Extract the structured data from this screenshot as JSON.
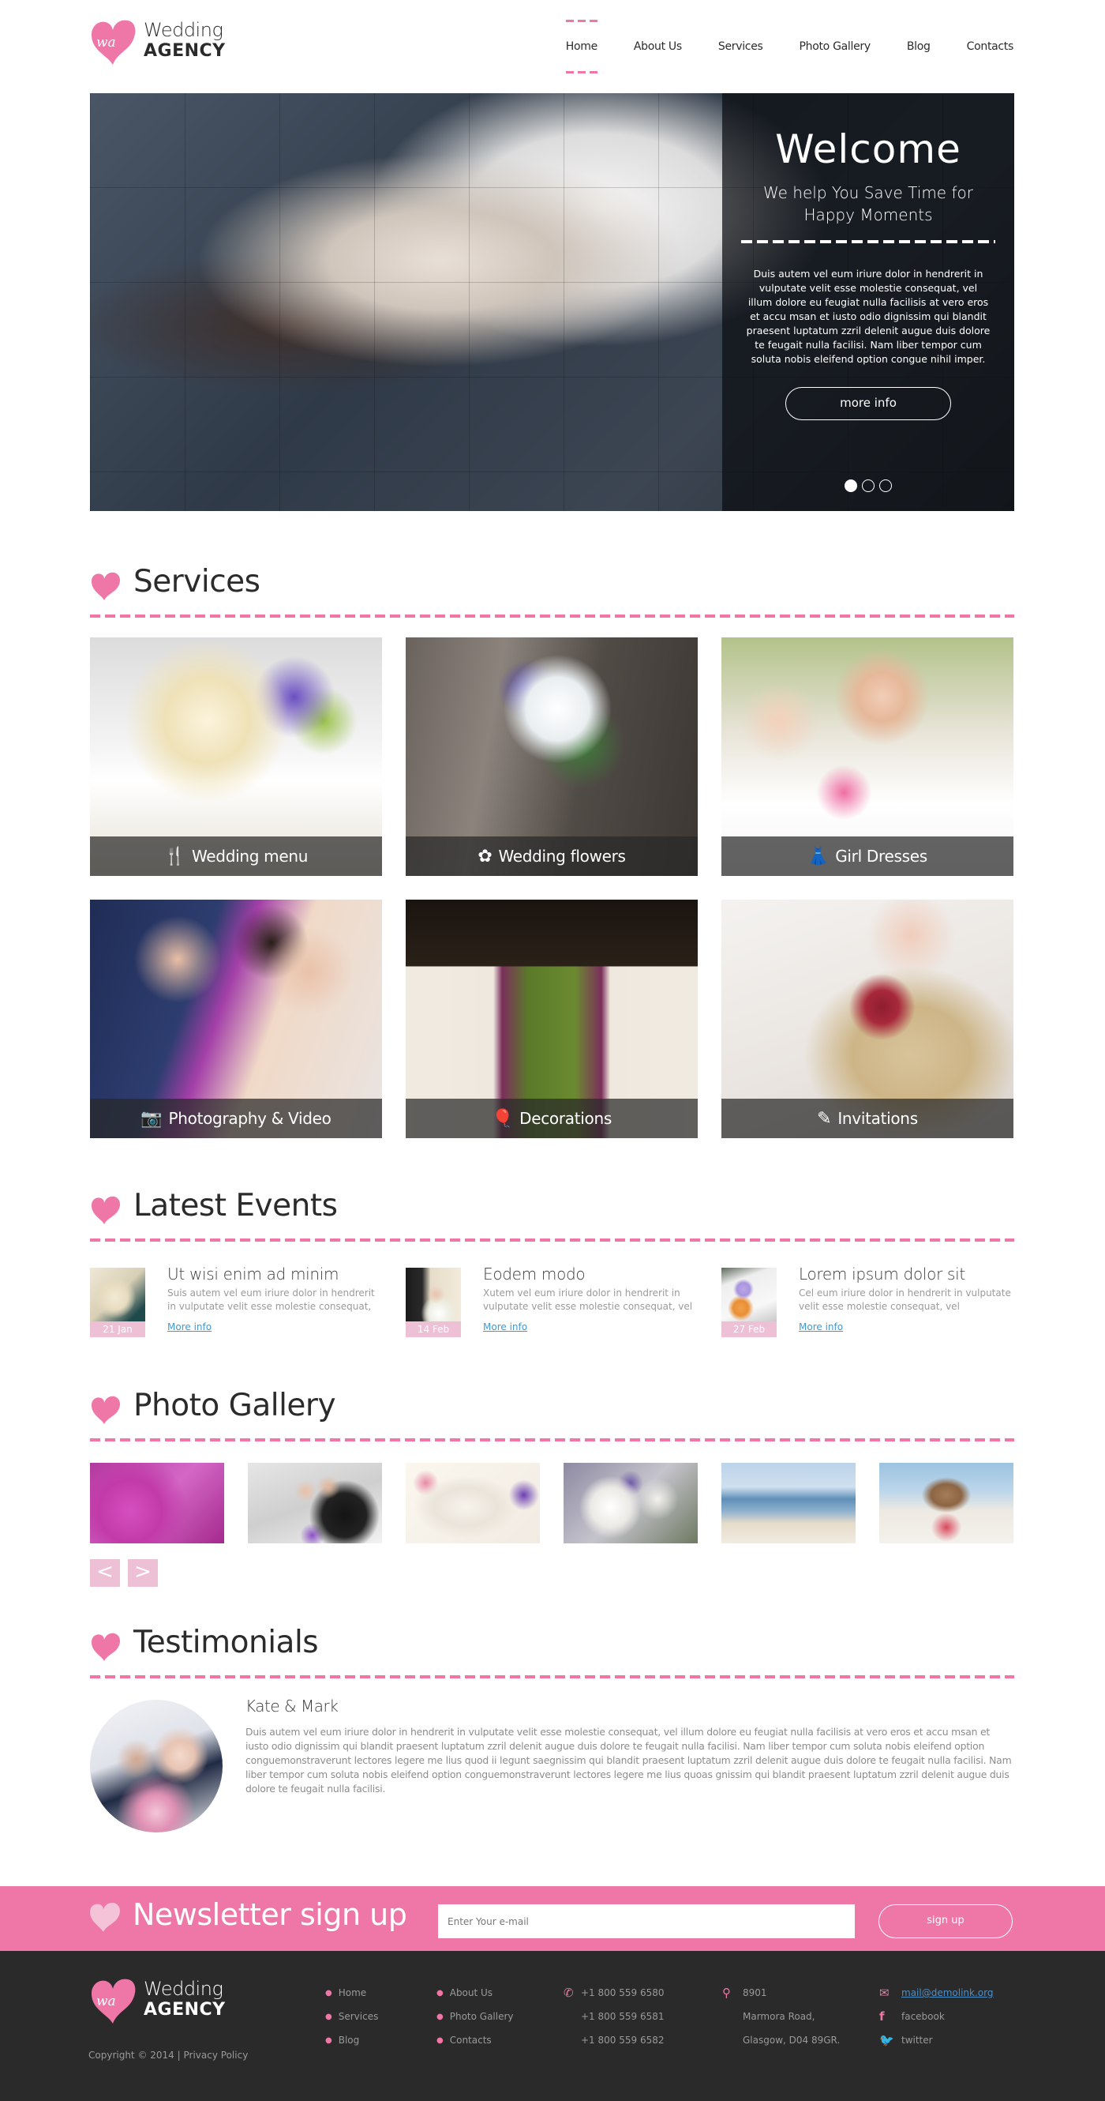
{
  "brand": {
    "logo_mark": "wa",
    "line1": "Wedding",
    "line2": "AGENCY"
  },
  "nav": {
    "items": [
      {
        "label": "Home",
        "active": true
      },
      {
        "label": "About Us",
        "active": false
      },
      {
        "label": "Services",
        "active": false
      },
      {
        "label": "Photo Gallery",
        "active": false
      },
      {
        "label": "Blog",
        "active": false
      },
      {
        "label": "Contacts",
        "active": false
      }
    ]
  },
  "hero": {
    "title": "Welcome",
    "subtitle": "We help You Save Time for Happy Moments",
    "body": "Duis autem vel eum iriure dolor in hendrerit in vulputate velit esse molestie consequat, vel illum dolore eu feugiat nulla facilisis at vero eros et accu msan et iusto odio dignissim qui blandit praesent luptatum zzril delenit augue duis dolore te feugait nulla facilisi. Nam liber tempor cum soluta nobis eleifend option congue nihil imper.",
    "button_label": "more info",
    "slides_total": 3,
    "slide_active": 1
  },
  "services": {
    "title": "Services",
    "items": [
      {
        "label": "Wedding menu",
        "icon": "fork-knife-icon",
        "glyph": "🍴"
      },
      {
        "label": "Wedding flowers",
        "icon": "flower-icon",
        "glyph": "✿"
      },
      {
        "label": "Girl Dresses",
        "icon": "dress-icon",
        "glyph": "👗"
      },
      {
        "label": "Photography & Video",
        "icon": "camera-icon",
        "glyph": "📷"
      },
      {
        "label": "Decorations",
        "icon": "balloons-icon",
        "glyph": "🎈"
      },
      {
        "label": "Invitations",
        "icon": "pencil-icon",
        "glyph": "✎"
      }
    ]
  },
  "events": {
    "title": "Latest Events",
    "items": [
      {
        "date": "21 Jan",
        "title": "Ut wisi enim ad minim",
        "text": "Suis autem vel eum iriure dolor in hendrerit in vulputate velit esse molestie consequat,",
        "link": "More info"
      },
      {
        "date": "14 Feb",
        "title": "Eodem modo",
        "text": "Xutem vel eum iriure dolor in hendrerit in vulputate velit esse molestie consequat, vel",
        "link": "More info"
      },
      {
        "date": "27 Feb",
        "title": "Lorem ipsum dolor sit",
        "text": "Cel eum iriure dolor in hendrerit in vulputate velit esse molestie consequat, vel",
        "link": "More info"
      }
    ]
  },
  "gallery": {
    "title": "Photo Gallery",
    "prev_label": "<",
    "next_label": ">",
    "photos": [
      "pink-roses",
      "couple-portrait",
      "wedding-cake",
      "white-roses",
      "beach-couple",
      "beach-gazebo"
    ]
  },
  "testimonials": {
    "title": "Testimonials",
    "name": "Kate & Mark",
    "text": "Duis autem vel eum iriure dolor in hendrerit in vulputate velit esse molestie consequat, vel illum dolore eu feugiat nulla facilisis at vero eros et accu msan et iusto odio dignissim qui blandit praesent luptatum zzril delenit augue duis dolore te feugait nulla facilisi. Nam liber tempor cum soluta nobis eleifend option conguemonstraverunt lectores legere me lius quod ii legunt saegnissim qui blandit praesent luptatum zzril delenit augue duis dolore te feugait nulla facilisi. Nam liber tempor cum soluta nobis eleifend option conguemonstraverunt lectores legere me lius quoas gnissim qui blandit praesent luptatum zzril delenit augue duis dolore te feugait nulla facilisi."
  },
  "newsletter": {
    "title": "Newsletter sign up",
    "placeholder": "Enter Your e-mail",
    "button_label": "sign up"
  },
  "footer": {
    "copyright": "Copyright © 2014",
    "separator": "|",
    "privacy": "Privacy Policy",
    "links_col1": [
      "Home",
      "Services",
      "Blog"
    ],
    "links_col2": [
      "About Us",
      "Photo Gallery",
      "Contacts"
    ],
    "phones": [
      "+1 800 559 6580",
      "+1 800 559 6581",
      "+1 800 559 6582"
    ],
    "address": [
      "8901",
      "Marmora Road,",
      "Glasgow, D04 89GR."
    ],
    "email": "mail@demolink.org",
    "facebook": "facebook",
    "twitter": "twitter"
  },
  "colors": {
    "accent": "#ef77a8",
    "accent_light": "#eec0d5",
    "footer_bg": "#2a2a2a",
    "link": "#3d9ad6"
  }
}
